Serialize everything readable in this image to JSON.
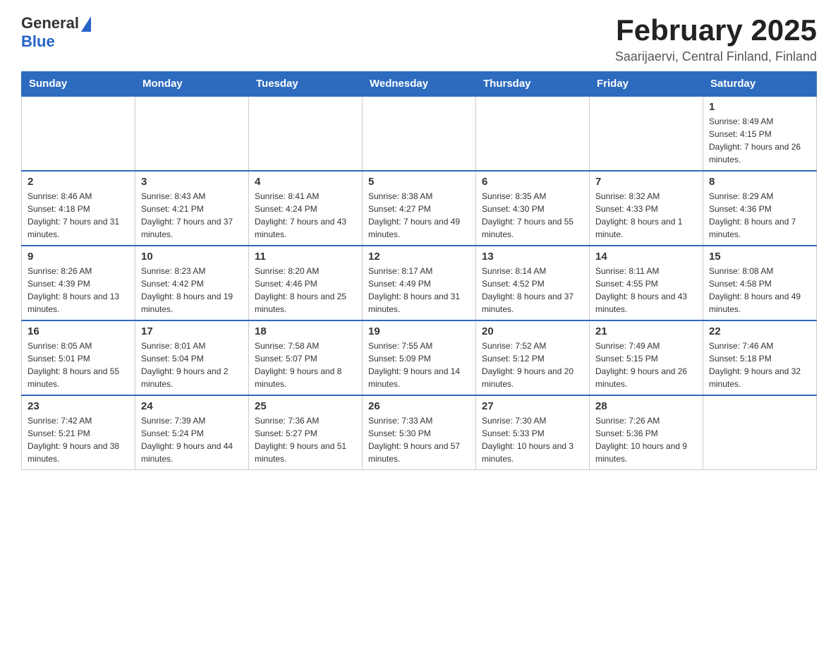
{
  "header": {
    "logo_general": "General",
    "logo_blue": "Blue",
    "month_title": "February 2025",
    "location": "Saarijaervi, Central Finland, Finland"
  },
  "weekdays": [
    "Sunday",
    "Monday",
    "Tuesday",
    "Wednesday",
    "Thursday",
    "Friday",
    "Saturday"
  ],
  "weeks": [
    [
      {
        "day": "",
        "sunrise": "",
        "sunset": "",
        "daylight": ""
      },
      {
        "day": "",
        "sunrise": "",
        "sunset": "",
        "daylight": ""
      },
      {
        "day": "",
        "sunrise": "",
        "sunset": "",
        "daylight": ""
      },
      {
        "day": "",
        "sunrise": "",
        "sunset": "",
        "daylight": ""
      },
      {
        "day": "",
        "sunrise": "",
        "sunset": "",
        "daylight": ""
      },
      {
        "day": "",
        "sunrise": "",
        "sunset": "",
        "daylight": ""
      },
      {
        "day": "1",
        "sunrise": "Sunrise: 8:49 AM",
        "sunset": "Sunset: 4:15 PM",
        "daylight": "Daylight: 7 hours and 26 minutes."
      }
    ],
    [
      {
        "day": "2",
        "sunrise": "Sunrise: 8:46 AM",
        "sunset": "Sunset: 4:18 PM",
        "daylight": "Daylight: 7 hours and 31 minutes."
      },
      {
        "day": "3",
        "sunrise": "Sunrise: 8:43 AM",
        "sunset": "Sunset: 4:21 PM",
        "daylight": "Daylight: 7 hours and 37 minutes."
      },
      {
        "day": "4",
        "sunrise": "Sunrise: 8:41 AM",
        "sunset": "Sunset: 4:24 PM",
        "daylight": "Daylight: 7 hours and 43 minutes."
      },
      {
        "day": "5",
        "sunrise": "Sunrise: 8:38 AM",
        "sunset": "Sunset: 4:27 PM",
        "daylight": "Daylight: 7 hours and 49 minutes."
      },
      {
        "day": "6",
        "sunrise": "Sunrise: 8:35 AM",
        "sunset": "Sunset: 4:30 PM",
        "daylight": "Daylight: 7 hours and 55 minutes."
      },
      {
        "day": "7",
        "sunrise": "Sunrise: 8:32 AM",
        "sunset": "Sunset: 4:33 PM",
        "daylight": "Daylight: 8 hours and 1 minute."
      },
      {
        "day": "8",
        "sunrise": "Sunrise: 8:29 AM",
        "sunset": "Sunset: 4:36 PM",
        "daylight": "Daylight: 8 hours and 7 minutes."
      }
    ],
    [
      {
        "day": "9",
        "sunrise": "Sunrise: 8:26 AM",
        "sunset": "Sunset: 4:39 PM",
        "daylight": "Daylight: 8 hours and 13 minutes."
      },
      {
        "day": "10",
        "sunrise": "Sunrise: 8:23 AM",
        "sunset": "Sunset: 4:42 PM",
        "daylight": "Daylight: 8 hours and 19 minutes."
      },
      {
        "day": "11",
        "sunrise": "Sunrise: 8:20 AM",
        "sunset": "Sunset: 4:46 PM",
        "daylight": "Daylight: 8 hours and 25 minutes."
      },
      {
        "day": "12",
        "sunrise": "Sunrise: 8:17 AM",
        "sunset": "Sunset: 4:49 PM",
        "daylight": "Daylight: 8 hours and 31 minutes."
      },
      {
        "day": "13",
        "sunrise": "Sunrise: 8:14 AM",
        "sunset": "Sunset: 4:52 PM",
        "daylight": "Daylight: 8 hours and 37 minutes."
      },
      {
        "day": "14",
        "sunrise": "Sunrise: 8:11 AM",
        "sunset": "Sunset: 4:55 PM",
        "daylight": "Daylight: 8 hours and 43 minutes."
      },
      {
        "day": "15",
        "sunrise": "Sunrise: 8:08 AM",
        "sunset": "Sunset: 4:58 PM",
        "daylight": "Daylight: 8 hours and 49 minutes."
      }
    ],
    [
      {
        "day": "16",
        "sunrise": "Sunrise: 8:05 AM",
        "sunset": "Sunset: 5:01 PM",
        "daylight": "Daylight: 8 hours and 55 minutes."
      },
      {
        "day": "17",
        "sunrise": "Sunrise: 8:01 AM",
        "sunset": "Sunset: 5:04 PM",
        "daylight": "Daylight: 9 hours and 2 minutes."
      },
      {
        "day": "18",
        "sunrise": "Sunrise: 7:58 AM",
        "sunset": "Sunset: 5:07 PM",
        "daylight": "Daylight: 9 hours and 8 minutes."
      },
      {
        "day": "19",
        "sunrise": "Sunrise: 7:55 AM",
        "sunset": "Sunset: 5:09 PM",
        "daylight": "Daylight: 9 hours and 14 minutes."
      },
      {
        "day": "20",
        "sunrise": "Sunrise: 7:52 AM",
        "sunset": "Sunset: 5:12 PM",
        "daylight": "Daylight: 9 hours and 20 minutes."
      },
      {
        "day": "21",
        "sunrise": "Sunrise: 7:49 AM",
        "sunset": "Sunset: 5:15 PM",
        "daylight": "Daylight: 9 hours and 26 minutes."
      },
      {
        "day": "22",
        "sunrise": "Sunrise: 7:46 AM",
        "sunset": "Sunset: 5:18 PM",
        "daylight": "Daylight: 9 hours and 32 minutes."
      }
    ],
    [
      {
        "day": "23",
        "sunrise": "Sunrise: 7:42 AM",
        "sunset": "Sunset: 5:21 PM",
        "daylight": "Daylight: 9 hours and 38 minutes."
      },
      {
        "day": "24",
        "sunrise": "Sunrise: 7:39 AM",
        "sunset": "Sunset: 5:24 PM",
        "daylight": "Daylight: 9 hours and 44 minutes."
      },
      {
        "day": "25",
        "sunrise": "Sunrise: 7:36 AM",
        "sunset": "Sunset: 5:27 PM",
        "daylight": "Daylight: 9 hours and 51 minutes."
      },
      {
        "day": "26",
        "sunrise": "Sunrise: 7:33 AM",
        "sunset": "Sunset: 5:30 PM",
        "daylight": "Daylight: 9 hours and 57 minutes."
      },
      {
        "day": "27",
        "sunrise": "Sunrise: 7:30 AM",
        "sunset": "Sunset: 5:33 PM",
        "daylight": "Daylight: 10 hours and 3 minutes."
      },
      {
        "day": "28",
        "sunrise": "Sunrise: 7:26 AM",
        "sunset": "Sunset: 5:36 PM",
        "daylight": "Daylight: 10 hours and 9 minutes."
      },
      {
        "day": "",
        "sunrise": "",
        "sunset": "",
        "daylight": ""
      }
    ]
  ]
}
